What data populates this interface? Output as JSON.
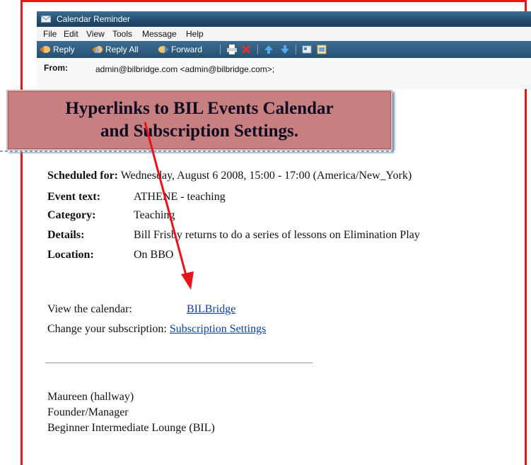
{
  "window": {
    "title": "Calendar Reminder",
    "menu": [
      "File",
      "Edit",
      "View",
      "Tools",
      "Message",
      "Help"
    ],
    "toolbar": {
      "reply": "Reply",
      "reply_all": "Reply All",
      "forward": "Forward"
    },
    "from_label": "From:",
    "from_value": "admin@bilbridge.com <admin@bilbridge.com>;"
  },
  "callout": {
    "line1": "Hyperlinks to BIL Events Calendar",
    "line2": "and Subscription Settings."
  },
  "event": {
    "scheduled_label": "Scheduled for:",
    "scheduled_value": "Wednesday, August 6 2008, 15:00 - 17:00 (America/New_York)",
    "fields": [
      {
        "label": "Event text:",
        "value": "ATHENE - teaching"
      },
      {
        "label": "Category:",
        "value": "Teaching"
      },
      {
        "label": "Details:",
        "value": "Bill Frisby returns to do a series of lessons on Elimination Play"
      },
      {
        "label": "Location:",
        "value": "On BBO"
      }
    ]
  },
  "links": {
    "calendar_label": "View the calendar:",
    "calendar_link": "BILBridge",
    "subscription_label": "Change your subscription:",
    "subscription_link": "Subscription Settings"
  },
  "signature": [
    "Maureen (hallway)",
    "Founder/Manager",
    "Beginner Intermediate Lounge (BIL)"
  ],
  "colors": {
    "frame": "#e8141a",
    "callout": "#c77f80",
    "link": "#0a3ea8",
    "toolbar": "#2f5b7e"
  },
  "icons": [
    "mail-icon",
    "reply-icon",
    "reply-all-icon",
    "forward-icon",
    "print-icon",
    "delete-icon",
    "previous-icon",
    "next-icon",
    "contacts-icon",
    "calendar-icon"
  ]
}
